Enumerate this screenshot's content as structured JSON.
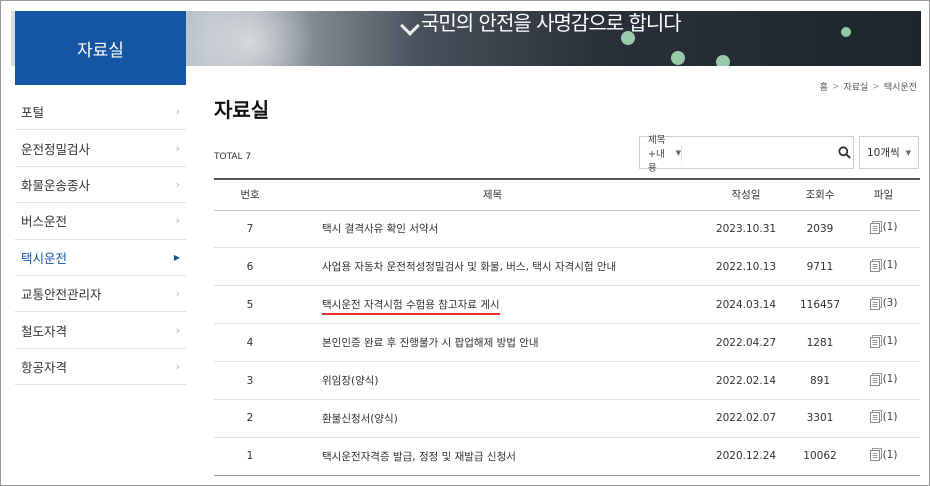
{
  "banner": {
    "title": "국민의 안전을 사명감으로 합니다"
  },
  "sidebar": {
    "title": "자료실",
    "items": [
      {
        "label": "포털",
        "active": false
      },
      {
        "label": "운전정밀검사",
        "active": false
      },
      {
        "label": "화물운송종사",
        "active": false
      },
      {
        "label": "버스운전",
        "active": false
      },
      {
        "label": "택시운전",
        "active": true
      },
      {
        "label": "교통안전관리자",
        "active": false
      },
      {
        "label": "철도자격",
        "active": false
      },
      {
        "label": "항공자격",
        "active": false
      }
    ]
  },
  "breadcrumb": {
    "home": "홈",
    "section": "자료실",
    "current": "택시운전",
    "separator": ">"
  },
  "page": {
    "title": "자료실",
    "total": "TOTAL 7"
  },
  "search": {
    "field_label": "제목+내용",
    "input_value": "",
    "per_page": "10개씩"
  },
  "table": {
    "headers": {
      "no": "번호",
      "title": "제목",
      "date": "작성일",
      "views": "조회수",
      "file": "파일"
    },
    "rows": [
      {
        "no": "7",
        "title": "택시 결격사유 확인 서약서",
        "date": "2023.10.31",
        "views": "2039",
        "file": "(1)"
      },
      {
        "no": "6",
        "title": "사업용 자동차 운전적성정밀검사 및 화물, 버스, 택시 자격시험 안내",
        "date": "2022.10.13",
        "views": "9711",
        "file": "(1)"
      },
      {
        "no": "5",
        "title": "택시운전 자격시험 수험용 참고자료 게시",
        "date": "2024.03.14",
        "views": "116457",
        "file": "(3)"
      },
      {
        "no": "4",
        "title": "본인인증 완료 후 진행불가 시 팝업해제 방법 안내",
        "date": "2022.04.27",
        "views": "1281",
        "file": "(1)"
      },
      {
        "no": "3",
        "title": "위임장(양식)",
        "date": "2022.02.14",
        "views": "891",
        "file": "(1)"
      },
      {
        "no": "2",
        "title": "환불신청서(양식)",
        "date": "2022.02.07",
        "views": "3301",
        "file": "(1)"
      },
      {
        "no": "1",
        "title": "택시운전자격증 발급, 정정 및 재발급 신청서",
        "date": "2020.12.24",
        "views": "10062",
        "file": "(1)"
      }
    ]
  },
  "colors": {
    "brand": "#1455a4",
    "underline": "#e8322f"
  }
}
